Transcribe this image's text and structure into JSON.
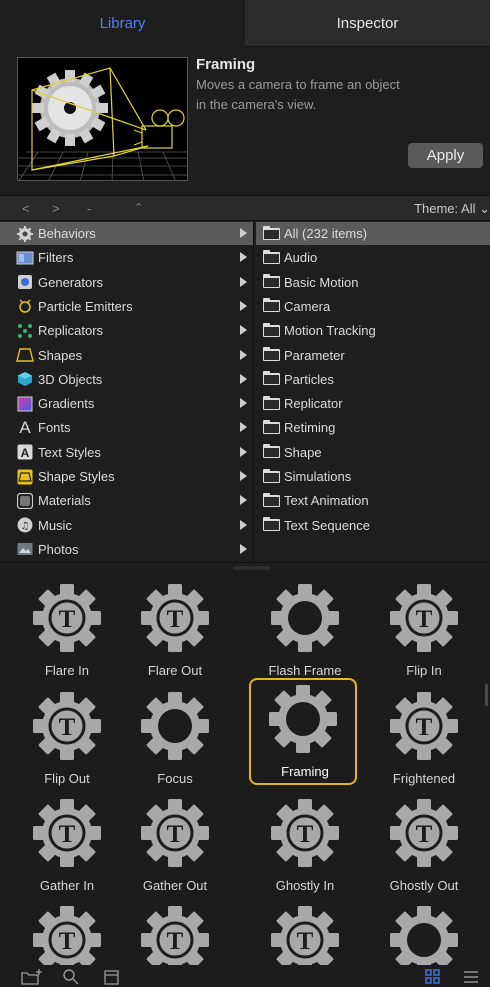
{
  "tabs": {
    "library": "Library",
    "inspector": "Inspector"
  },
  "preview": {
    "title": "Framing",
    "description": "Moves a camera to frame an object in the camera's view.",
    "apply_label": "Apply"
  },
  "navbar": {
    "back": "<",
    "forward": ">",
    "dash": "-",
    "stepper": "⌃",
    "theme": "Theme: All ⌄"
  },
  "categories": [
    {
      "label": "Behaviors",
      "icon": "gear-icon",
      "selected": true
    },
    {
      "label": "Filters",
      "icon": "filters-icon"
    },
    {
      "label": "Generators",
      "icon": "generators-icon"
    },
    {
      "label": "Particle Emitters",
      "icon": "particle-emitter-icon"
    },
    {
      "label": "Replicators",
      "icon": "replicator-icon"
    },
    {
      "label": "Shapes",
      "icon": "shapes-icon"
    },
    {
      "label": "3D Objects",
      "icon": "cube-icon"
    },
    {
      "label": "Gradients",
      "icon": "gradient-icon"
    },
    {
      "label": "Fonts",
      "icon": "font-icon"
    },
    {
      "label": "Text Styles",
      "icon": "text-style-icon"
    },
    {
      "label": "Shape Styles",
      "icon": "shape-style-icon"
    },
    {
      "label": "Materials",
      "icon": "materials-icon"
    },
    {
      "label": "Music",
      "icon": "music-icon"
    },
    {
      "label": "Photos",
      "icon": "photos-icon"
    }
  ],
  "subcategories": [
    {
      "label": "All (232 items)",
      "selected": true
    },
    {
      "label": "Audio"
    },
    {
      "label": "Basic Motion"
    },
    {
      "label": "Camera"
    },
    {
      "label": "Motion Tracking"
    },
    {
      "label": "Parameter"
    },
    {
      "label": "Particles"
    },
    {
      "label": "Replicator"
    },
    {
      "label": "Retiming"
    },
    {
      "label": "Shape"
    },
    {
      "label": "Simulations"
    },
    {
      "label": "Text Animation"
    },
    {
      "label": "Text Sequence"
    }
  ],
  "items": [
    {
      "label": "Flare In",
      "icon": "text-behavior-icon"
    },
    {
      "label": "Flare Out",
      "icon": "text-behavior-icon"
    },
    {
      "label": "Flash Frame",
      "icon": "behavior-gear-icon"
    },
    {
      "label": "Flip In",
      "icon": "text-behavior-icon"
    },
    {
      "label": "Flip Out",
      "icon": "text-behavior-icon"
    },
    {
      "label": "Focus",
      "icon": "behavior-gear-icon"
    },
    {
      "label": "Framing",
      "icon": "behavior-gear-icon",
      "selected": true
    },
    {
      "label": "Frightened",
      "icon": "text-behavior-icon"
    },
    {
      "label": "Gather In",
      "icon": "text-behavior-icon"
    },
    {
      "label": "Gather Out",
      "icon": "text-behavior-icon"
    },
    {
      "label": "Ghostly In",
      "icon": "text-behavior-icon"
    },
    {
      "label": "Ghostly Out",
      "icon": "text-behavior-icon"
    },
    {
      "label": "",
      "icon": "text-behavior-icon"
    },
    {
      "label": "",
      "icon": "text-behavior-icon"
    },
    {
      "label": "",
      "icon": "text-behavior-icon"
    },
    {
      "label": "",
      "icon": "behavior-gear-icon"
    }
  ],
  "bottombar": {
    "icons": [
      "new-folder-icon",
      "search-icon",
      "preview-toggle-icon",
      "grid-view-icon",
      "list-view-icon"
    ]
  },
  "colors": {
    "accent": "#4f7df9",
    "selection_border": "#e2b81f",
    "gear": "#a8a8a8",
    "thumb_lines": "#e0d234"
  }
}
